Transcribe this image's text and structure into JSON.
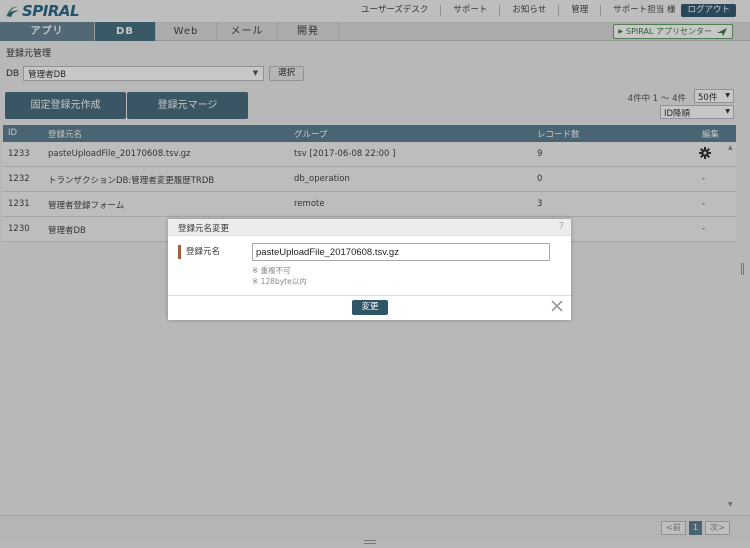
{
  "header": {
    "logo_text": "SPIRAL",
    "links": [
      "ユーザーズデスク",
      "サポート",
      "お知らせ",
      "管理"
    ],
    "user_name": "サポート担当 様",
    "logout_label": "ログアウト"
  },
  "nav": {
    "tabs": [
      {
        "label": "アプリ"
      },
      {
        "label": "DB"
      },
      {
        "label": "Web"
      },
      {
        "label": "メール"
      },
      {
        "label": "開発"
      }
    ],
    "app_center_label": "SPIRAL アプリセンター"
  },
  "page": {
    "section_title": "登録元管理",
    "db_label": "DB",
    "db_select_value": "管理者DB",
    "select_button": "選択",
    "fixed_create_button": "固定登録元作成",
    "merge_button": "登録元マージ",
    "pager_info": "4件中 1 ～ 4件",
    "per_page_value": "50件",
    "sort_value": "ID降順"
  },
  "table": {
    "headers": [
      "ID",
      "登録元名",
      "グループ",
      "レコード数",
      "編集"
    ],
    "rows": [
      {
        "id": "1233",
        "name": "pasteUploadFile_20170608.tsv.gz",
        "group": "tsv [2017-06-08 22:00 ]",
        "count": "9",
        "edit": ""
      },
      {
        "id": "1232",
        "name": "トランザクションDB:管理者変更履歴TRDB",
        "group": "db_operation",
        "count": "0",
        "edit": "-"
      },
      {
        "id": "1231",
        "name": "管理者登録フォーム",
        "group": "remote",
        "count": "3",
        "edit": "-"
      },
      {
        "id": "1230",
        "name": "管理者DB",
        "group": "",
        "count": "",
        "edit": "-"
      }
    ]
  },
  "footer": {
    "prev_label": "<前",
    "current_page": "1",
    "next_label": "次>"
  },
  "modal": {
    "title": "登録元名変更",
    "help": "?",
    "field_label": "登録元名",
    "input_value": "pasteUploadFile_20170608.tsv.gz",
    "note1": "※ 重複不可",
    "note2": "※ 128byte以内",
    "change_button": "変更"
  }
}
